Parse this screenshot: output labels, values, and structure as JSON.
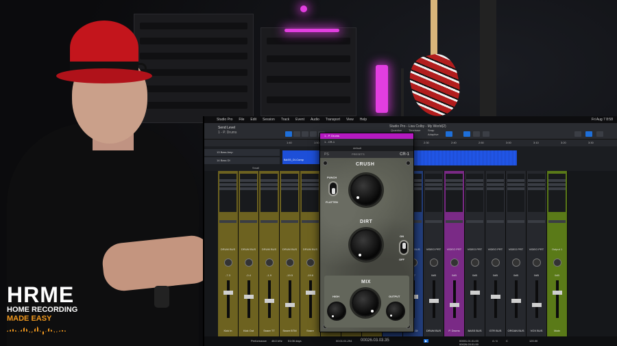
{
  "logo": {
    "line1": "HRME",
    "line2": "HOME RECORDING",
    "line3": "MADE EASY",
    "accent_color": "#f39a1f"
  },
  "daw": {
    "app_name": "Studio Pro",
    "menus": [
      "Studio Pro",
      "File",
      "Edit",
      "Session",
      "Track",
      "Event",
      "Audio",
      "Transport",
      "View",
      "Help"
    ],
    "clock": "Fri Aug 7 8:58",
    "song_name": "Send Level",
    "song_sub": "1 - P. Drums",
    "window_title": "Studio Pro - Lisa Colby - My World(2)",
    "toolbar_labels": {
      "quantize": "Quantize",
      "timebase": "Timebase",
      "snap": "Snap",
      "adaptive": "Adaptive"
    },
    "ruler_ticks": [
      "1:40",
      "1:50",
      "2:00",
      "2:10",
      "2:20",
      "2:30",
      "2:40",
      "2:50",
      "3:00",
      "3:10",
      "3:20",
      "3:30"
    ],
    "tracks": [
      {
        "num": "13",
        "name": "Bass Amp"
      },
      {
        "num": "14",
        "name": "Bass DI"
      }
    ],
    "clip_label": "BASS_DI-Comp",
    "mixer_view": "Small",
    "strips": [
      {
        "name": "Kick In",
        "bus": "DRUM BUS",
        "val": "-7.3",
        "color": "gold"
      },
      {
        "name": "Kick Out",
        "bus": "DRUM BUS",
        "val": "-0.4",
        "color": "gold"
      },
      {
        "name": "Snare TT",
        "bus": "DRUM BUS",
        "val": "-1.9",
        "color": "gold"
      },
      {
        "name": "Snare BTM",
        "bus": "DRUM BUS",
        "val": "-19.5",
        "color": "gold"
      },
      {
        "name": "Snare",
        "bus": "DRUM BUS",
        "val": "-19.6",
        "color": "gold"
      },
      {
        "name": "Hi Hat",
        "bus": "DRUM BUS",
        "val": "-2.5",
        "color": "gold"
      },
      {
        "name": "Tom Right",
        "bus": "DRUM BUS",
        "val": "-17.6",
        "color": "gold"
      },
      {
        "name": "Tambo",
        "bus": "DRUM BUS",
        "val": "-22.7",
        "color": "gold"
      },
      {
        "name": "Bass Amp",
        "bus": "BASS BUS",
        "val": "-7.8",
        "color": "blue"
      },
      {
        "name": "Bass DI",
        "bus": "BASS BUS",
        "val": "-4.7",
        "color": "blue"
      },
      {
        "name": "DRUM BUS",
        "bus": "VIDEO PRT",
        "val": "0dB",
        "color": "dark"
      },
      {
        "name": "P. Drums",
        "bus": "VIDEO PRT",
        "val": "0dB",
        "color": "purple"
      },
      {
        "name": "BASS BUS",
        "bus": "VIDEO PRT",
        "val": "0dB",
        "color": "dark"
      },
      {
        "name": "GTR BUS",
        "bus": "VIDEO PRT",
        "val": "0dB",
        "color": "dark"
      },
      {
        "name": "ORGAN BUS",
        "bus": "VIDEO PRT",
        "val": "0dB",
        "color": "dark"
      },
      {
        "name": "VOX BUS",
        "bus": "VIDEO PRT",
        "val": "0dB",
        "color": "dark"
      },
      {
        "name": "Main",
        "bus": "Output 1",
        "val": "0dB",
        "color": "green"
      }
    ],
    "transport": {
      "performance": "Performance",
      "sample_rate": "48.0 kHz",
      "record_time": "51:06 days",
      "time": "00:01:01.294",
      "bars": "00026.03.03.35",
      "loop_start": "00001.01.01.00",
      "loop_end": "00026.03.01.00",
      "signature": "4 / 4",
      "tempo": "120.00",
      "key": "C"
    }
  },
  "plugin": {
    "title": "1 - P. Drums",
    "insert": "1 - CR-1",
    "preset": "default",
    "brand": "PS",
    "presets_label": "PRESETS",
    "model": "CR-1",
    "labels": {
      "crush": "CRUSH",
      "punch": "PUNCH",
      "flatten": "FLATTEN",
      "dirt": "DIRT",
      "on": "ON",
      "off": "OFF",
      "mix": "MIX",
      "high": "HIGH",
      "output": "OUTPUT"
    }
  }
}
